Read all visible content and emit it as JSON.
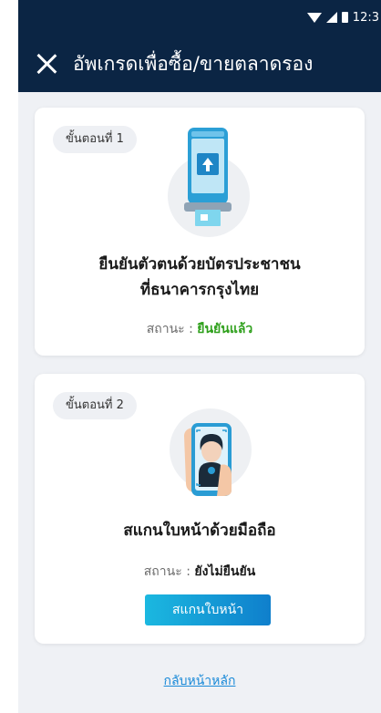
{
  "status_bar": {
    "time": "12:3"
  },
  "header": {
    "title": "อัพเกรดเพื่อซื้อ/ขายตลาดรอง"
  },
  "steps": [
    {
      "badge": "ขั้นตอนที่ 1",
      "title_line1": "ยืนยันตัวตนด้วยบัตรประชาชน",
      "title_line2": "ที่ธนาคารกรุงไทย",
      "status_label": "สถานะ :",
      "status_value": "ยืนยันแล้ว"
    },
    {
      "badge": "ขั้นตอนที่ 2",
      "title_line1": "สแกนใบหน้าด้วยมือถือ",
      "status_label": "สถานะ :",
      "status_value": "ยังไม่ยืนยัน",
      "button_label": "สแกนใบหน้า"
    }
  ],
  "footer": {
    "back_link": "กลับหน้าหลัก"
  },
  "colors": {
    "header_bg": "#0b2544",
    "verified": "#2fa01c",
    "button_start": "#1bb8e0",
    "button_end": "#0f7fcc",
    "link": "#1a8ad8"
  }
}
